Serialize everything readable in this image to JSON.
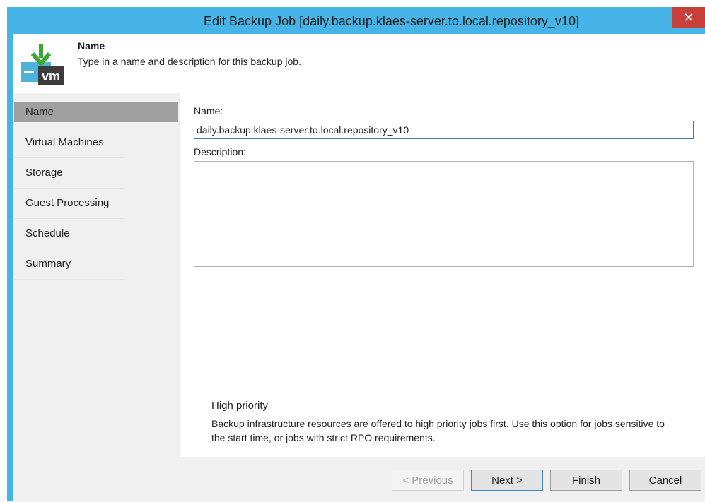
{
  "window": {
    "title": "Edit Backup Job [daily.backup.klaes-server.to.local.repository_v10]",
    "close_glyph": "✕"
  },
  "header": {
    "title": "Name",
    "subtitle": "Type in a name and description for this backup job.",
    "icon_text": "vm"
  },
  "sidebar": {
    "items": [
      {
        "label": "Name",
        "active": true
      },
      {
        "label": "Virtual Machines",
        "active": false
      },
      {
        "label": "Storage",
        "active": false
      },
      {
        "label": "Guest Processing",
        "active": false
      },
      {
        "label": "Schedule",
        "active": false
      },
      {
        "label": "Summary",
        "active": false
      }
    ]
  },
  "form": {
    "name_label": "Name:",
    "name_value": "daily.backup.klaes-server.to.local.repository_v10",
    "description_label": "Description:",
    "description_value": "",
    "high_priority_label": "High priority",
    "high_priority_checked": false,
    "high_priority_description": "Backup infrastructure resources are offered to high priority jobs first. Use this option for jobs sensitive to the start time, or jobs with strict RPO requirements."
  },
  "buttons": {
    "previous": "< Previous",
    "next": "Next >",
    "finish": "Finish",
    "cancel": "Cancel"
  },
  "colors": {
    "titlebar": "#46b4e6",
    "close": "#c7403a",
    "sidebar_active": "#a0a0a0",
    "icon_green": "#3aaa35",
    "icon_blue": "#4fb1dd",
    "icon_dark": "#3c3c3c"
  }
}
